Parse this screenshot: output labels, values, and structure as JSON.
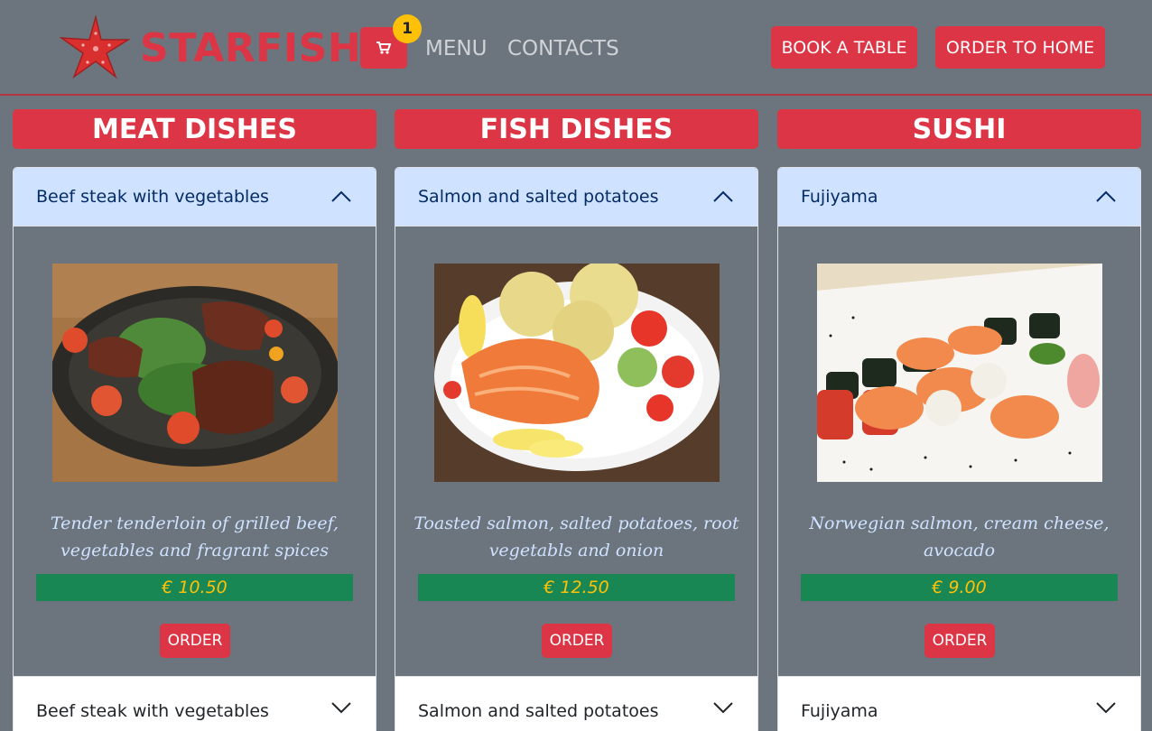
{
  "header": {
    "brand": "STARFISH",
    "cart_count": "1",
    "nav": {
      "menu": "MENU",
      "contacts": "CONTACTS"
    },
    "buttons": {
      "book": "BOOK A TABLE",
      "order_home": "ORDER TO HOME"
    }
  },
  "colors": {
    "background": "#6c757d",
    "accent": "#dc3545",
    "price_bg": "#198754",
    "price_text": "#ffc107",
    "accordion_active": "#cfe2ff",
    "badge": "#ffc107"
  },
  "categories": [
    {
      "title": "MEAT DISHES",
      "open_item": "Beef steak with vegetables",
      "description": "Tender tenderloin of grilled beef, vegetables and fragrant spices",
      "price": "€ 10.50",
      "order_label": "ORDER",
      "next_item": "Beef steak with vegetables"
    },
    {
      "title": "FISH DISHES",
      "open_item": "Salmon and salted potatoes",
      "description": "Toasted salmon, salted potatoes, root vegetabls and onion",
      "price": "€ 12.50",
      "order_label": "ORDER",
      "next_item": "Salmon and salted potatoes"
    },
    {
      "title": "SUSHI",
      "open_item": "Fujiyama",
      "description": "Norwegian salmon, cream cheese, avocado",
      "price": "€ 9.00",
      "order_label": "ORDER",
      "next_item": "Fujiyama"
    }
  ]
}
